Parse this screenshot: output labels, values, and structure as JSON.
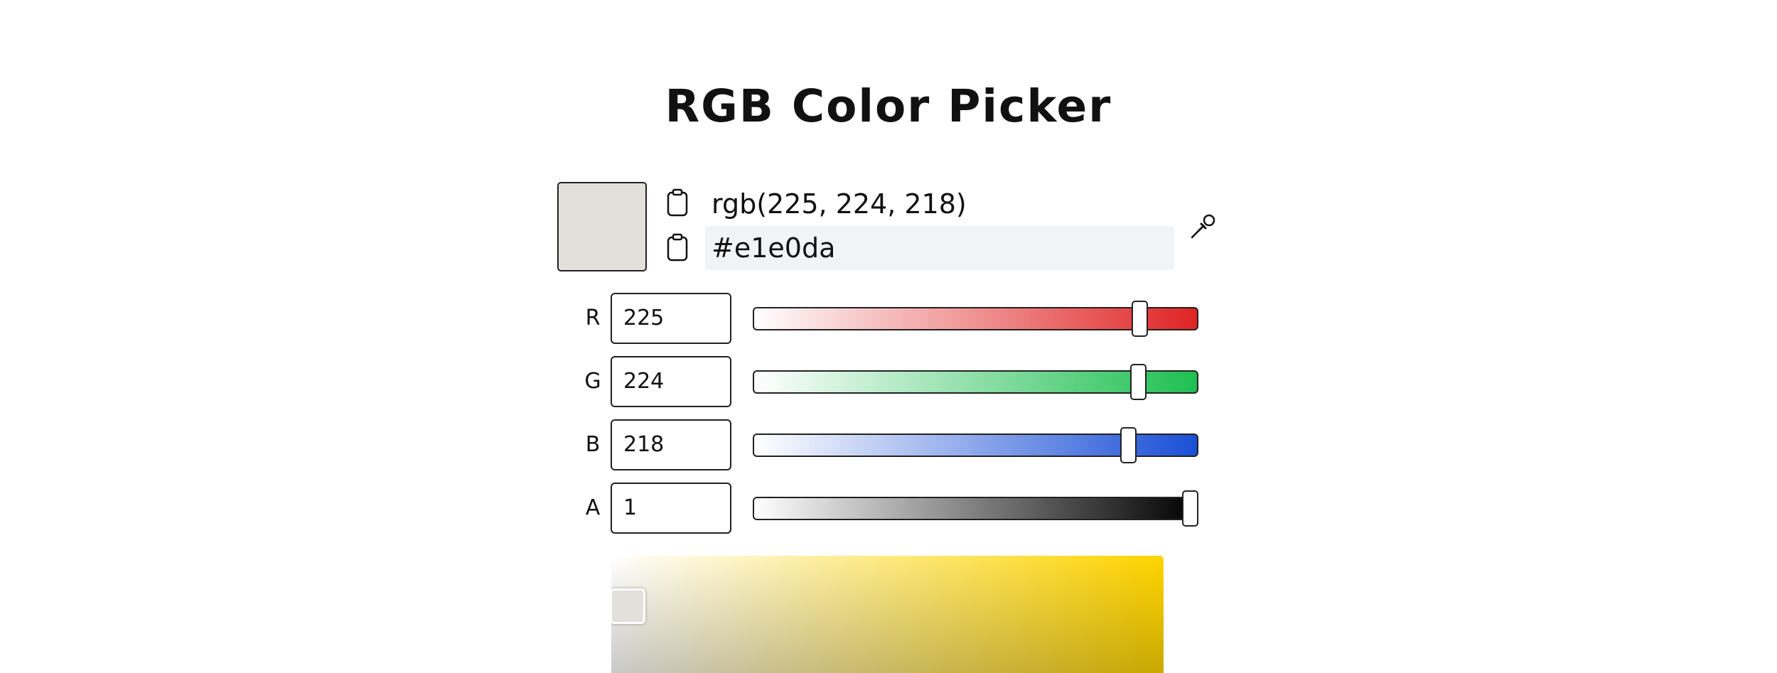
{
  "title": "RGB Color Picker",
  "current_color": {
    "rgb_text": "rgb(225, 224, 218)",
    "hex_text": "#e1e0da",
    "swatch_color": "#e1e0da"
  },
  "icons": {
    "copy_rgb": "clipboard-icon",
    "copy_hex": "clipboard-icon",
    "eyedropper": "eyedropper-icon"
  },
  "channels": [
    {
      "label": "R",
      "value": "225",
      "fraction": 0.882,
      "color": "#e02424"
    },
    {
      "label": "G",
      "value": "224",
      "fraction": 0.878,
      "color": "#1fbf52"
    },
    {
      "label": "B",
      "value": "218",
      "fraction": 0.855,
      "color": "#1a4fd6"
    },
    {
      "label": "A",
      "value": "1",
      "fraction": 1.0,
      "color": "#000000"
    }
  ],
  "saturation_value_area": {
    "hue_color": "#ffd500",
    "saturation": 0.0,
    "value": 0.88
  }
}
